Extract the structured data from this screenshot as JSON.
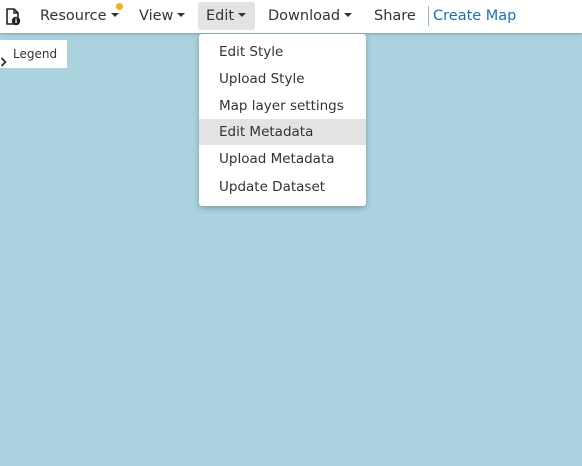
{
  "toolbar": {
    "doc_icon": "document-info-icon",
    "menu": {
      "resource": "Resource",
      "view": "View",
      "edit": "Edit",
      "download": "Download",
      "share": "Share",
      "create_map": "Create Map"
    },
    "notification_color": "#f2b01e"
  },
  "legend": {
    "label": "Legend",
    "icon": "chevron-right-icon"
  },
  "edit_dropdown": {
    "items": [
      "Edit Style",
      "Upload Style",
      "Map layer settings",
      "Edit Metadata",
      "Upload Metadata",
      "Update Dataset"
    ],
    "highlighted": "Edit Metadata"
  },
  "colors": {
    "map_background": "#aad3df",
    "link": "#1a6fc0",
    "active_background": "#e3e3e3"
  }
}
